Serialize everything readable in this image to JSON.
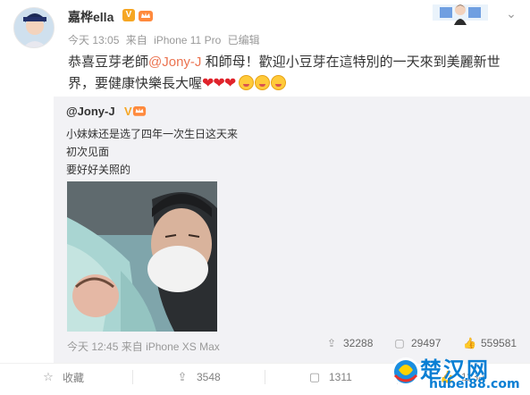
{
  "post": {
    "username": "嘉桦ella",
    "vip_mark": "V",
    "time": "今天 13:05",
    "source_prefix": "来自",
    "source": "iPhone 11 Pro",
    "edited": "已编辑",
    "text_1": "恭喜豆芽老師",
    "mention": "@Jony-J",
    "text_2": " 和師母！歡迎小豆芽在這特別的一天來到美麗新世界，要健康快樂長大喔",
    "hearts": "❤❤❤"
  },
  "repost": {
    "username": "@Jony-J",
    "vip_mark": "V",
    "lines": [
      "小妹妹还是选了四年一次生日这天来",
      "初次见面",
      "要好好关照的"
    ],
    "time": "今天 12:45",
    "source_prefix": "来自",
    "source": "iPhone XS Max",
    "stats": {
      "reposts": "32288",
      "comments": "29497",
      "likes": "559581"
    }
  },
  "actions": {
    "favorite": "收藏",
    "repost": "3548",
    "comment": "1311",
    "like": "1130"
  },
  "icons": {
    "favorite": "star-icon",
    "repost": "repost-icon",
    "comment": "comment-icon",
    "like": "thumbs-up-icon",
    "menu": "chevron-down-icon"
  },
  "watermark": {
    "title": "楚汉网",
    "url": "hubei88.com"
  },
  "colors": {
    "mention": "#eb7350",
    "repost_bg": "#f2f2f5",
    "vip": "#f6a623",
    "watermark": "#0a7fd4"
  }
}
